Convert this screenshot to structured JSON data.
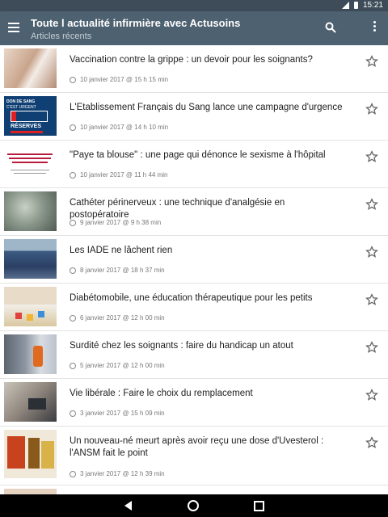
{
  "status_bar": {
    "time": "15:21"
  },
  "toolbar": {
    "title": "Toute l actualité infirmière avec Actusoins",
    "subtitle": "Articles récents"
  },
  "colors": {
    "toolbar": "#4d6170",
    "status_bar": "#3d4c58",
    "star": "#666666"
  },
  "articles": [
    {
      "headline": "Vaccination contre la grippe : un devoir pour les soignants?",
      "date": "10 janvier 2017 @ 15 h 15 min",
      "thumb": "photo-injection"
    },
    {
      "headline": "L'Etablissement Français du Sang lance une campagne d'urgence",
      "date": "10 janvier 2017 @ 14 h 10 min",
      "thumb": "blood-reserves-banner",
      "thumb_text": {
        "line1": "DON DE SANG",
        "line2": "C'EST URGENT",
        "line3": "RÉSERVES"
      }
    },
    {
      "headline": "\"Paye ta blouse\" : une page qui dénonce le sexisme à l'hôpital",
      "date": "10 janvier 2017 @ 11 h 44 min",
      "thumb": "quote-card"
    },
    {
      "headline": "Cathéter périnerveux : une technique d'analgésie en postopératoire",
      "date": "9 janvier 2017 @ 9 h 38 min",
      "thumb": "photo-catheter"
    },
    {
      "headline": "Les IADE ne lâchent rien",
      "date": "8 janvier 2017 @ 18 h 37 min",
      "thumb": "photo-crowd"
    },
    {
      "headline": "Diabétomobile, une éducation thérapeutique pour les petits",
      "date": "6 janvier 2017 @ 12 h 00 min",
      "thumb": "photo-table"
    },
    {
      "headline": "Surdité chez les soignants : faire du handicap un atout",
      "date": "5 janvier 2017 @ 12 h 00 min",
      "thumb": "photo-room"
    },
    {
      "headline": "Vie libérale : Faire le choix du remplacement",
      "date": "3 janvier 2017 @ 15 h 09 min",
      "thumb": "photo-laptop"
    },
    {
      "headline": "Un nouveau-né meurt après avoir reçu une dose d'Uvesterol : l'ANSM fait le point",
      "date": "3 janvier 2017 @ 12 h 39 min",
      "thumb": "photo-medicine-boxes"
    }
  ]
}
